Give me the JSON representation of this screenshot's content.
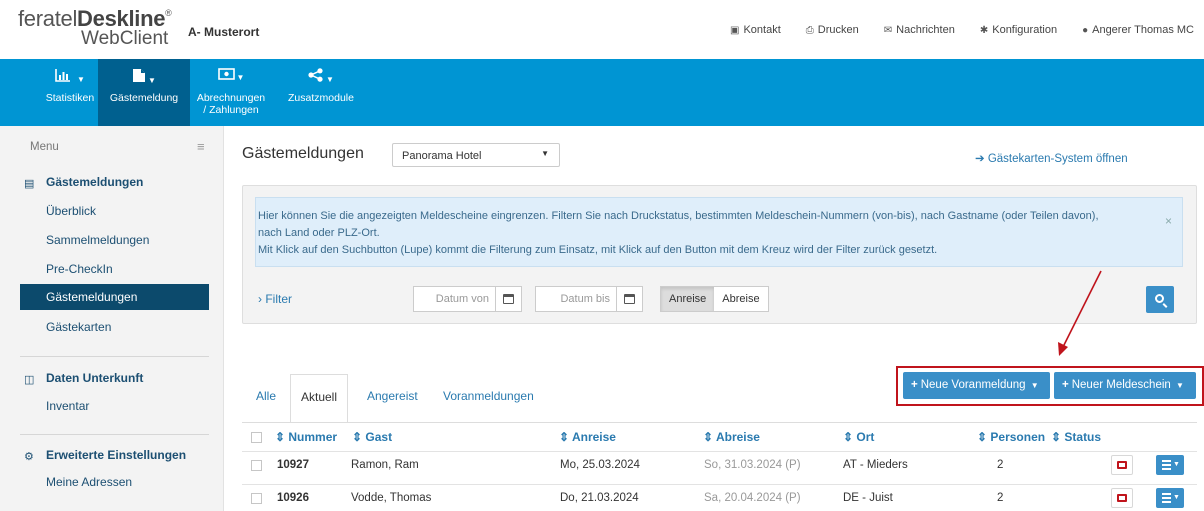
{
  "header": {
    "logo_brand_light": "feratel",
    "logo_brand_bold": "Deskline",
    "logo_registered": "®",
    "logo_product": "WebClient",
    "place": "A- Musterort",
    "links": [
      {
        "label": "Kontakt",
        "icon": "contact-card-icon"
      },
      {
        "label": "Drucken",
        "icon": "print-icon"
      },
      {
        "label": "Nachrichten",
        "icon": "envelope-icon"
      },
      {
        "label": "Konfiguration",
        "icon": "gear-icon"
      },
      {
        "label": "Angerer Thomas MC",
        "icon": "user-icon"
      }
    ]
  },
  "nav": [
    {
      "label": "Statistiken",
      "icon": "bar-chart-icon",
      "active": false
    },
    {
      "label": "Gästemeldung",
      "icon": "document-icon",
      "active": true
    },
    {
      "label_line1": "Abrechnungen",
      "label_line2": "/ Zahlungen",
      "icon": "money-icon",
      "active": false
    },
    {
      "label": "Zusatzmodule",
      "icon": "share-icon",
      "active": false
    }
  ],
  "sidebar": {
    "menu_label": "Menu",
    "sections": [
      {
        "title": "Gästemeldungen",
        "icon": "list-icon",
        "items": [
          "Überblick",
          "Sammelmeldungen",
          "Pre-CheckIn",
          "Gästemeldungen",
          "Gästekarten"
        ],
        "active_item": "Gästemeldungen"
      },
      {
        "title": "Daten Unterkunft",
        "icon": "columns-icon",
        "items": [
          "Inventar"
        ]
      },
      {
        "title": "Erweiterte Einstellungen",
        "icon": "cogs-icon",
        "items": [
          "Meine Adressen"
        ]
      }
    ]
  },
  "main": {
    "title": "Gästemeldungen",
    "hotel_select": "Panorama Hotel",
    "gaestekarten_link": "Gästekarten-System öffnen",
    "info_lines": [
      "Hier können Sie die angezeigten Meldescheine eingrenzen. Filtern Sie nach Druckstatus, bestimmten Meldeschein-Nummern (von-bis), nach Gastname (oder Teilen davon),",
      "nach Land oder PLZ-Ort.",
      "Mit Klick auf den Suchbutton (Lupe) kommt die Filterung zum Einsatz, mit Klick auf den Button mit dem Kreuz wird der Filter zurück gesetzt."
    ],
    "info_close": "×",
    "filter_label": "Filter",
    "date_from_placeholder": "Datum von",
    "date_to_placeholder": "Datum bis",
    "toggle": {
      "arrival": "Anreise",
      "departure": "Abreise",
      "selected": "Anreise"
    },
    "tabs": [
      "Alle",
      "Aktuell",
      "Angereist",
      "Voranmeldungen"
    ],
    "active_tab": "Aktuell",
    "buttons": {
      "new_prereg": "Neue Voranmeldung",
      "new_form": "Neuer Meldeschein"
    }
  },
  "table": {
    "columns": [
      "Nummer",
      "Gast",
      "Anreise",
      "Abreise",
      "Ort",
      "Personen",
      "Status"
    ],
    "rows": [
      {
        "nummer": "10927",
        "gast": "Ramon, Ram",
        "anreise": "Mo, 25.03.2024",
        "abreise": "So, 31.03.2024 (P)",
        "ort": "AT - Mieders",
        "personen": "2"
      },
      {
        "nummer": "10926",
        "gast": "Vodde, Thomas",
        "anreise": "Do, 21.03.2024",
        "abreise": "Sa, 20.04.2024 (P)",
        "ort": "DE - Juist",
        "personen": "2"
      }
    ]
  },
  "colors": {
    "nav_blue": "#0095d3",
    "nav_active": "#00608f",
    "sidebar_active": "#0c4a6c",
    "button_blue": "#3a8fc8",
    "annotation_red": "#c0141c"
  }
}
